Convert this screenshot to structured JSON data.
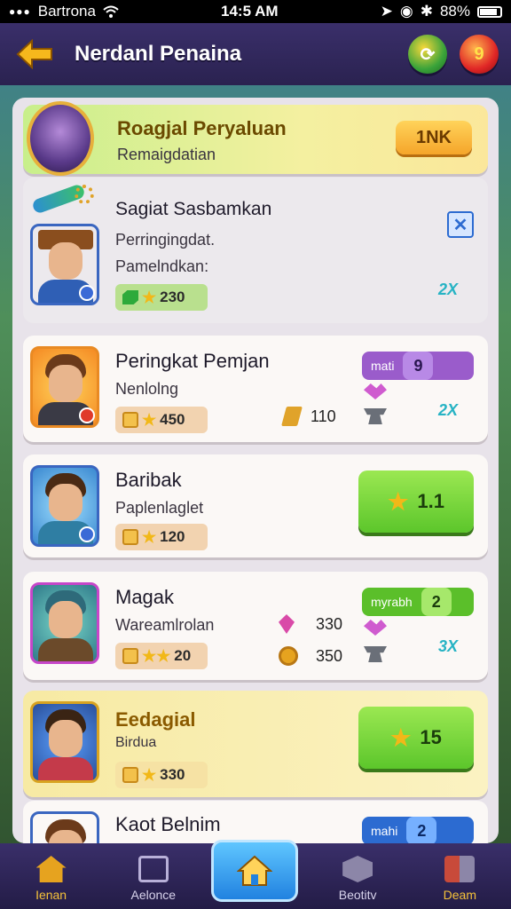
{
  "status_bar": {
    "carrier": "Bartrona",
    "time": "14:5 AM",
    "battery": "88%"
  },
  "header": {
    "title": "Nerdanl Penaina",
    "back_icon": "back-arrow-icon",
    "btn1_icon": "refresh-icon",
    "btn2_label": "9"
  },
  "cards": [
    {
      "name": "Roagjal Peryaluan",
      "sub": "Remaigdatian",
      "button": "1NK"
    },
    {
      "name": "Sagiat Sasbamkan",
      "line1": "Perringingdat.",
      "line2": "Pamelndkan:",
      "score": "230",
      "mult": "2X"
    },
    {
      "name": "Peringkat Pemjan",
      "sub": "Nenlolng",
      "score": "450",
      "pill_label": "mati",
      "pill_value": "9",
      "res_value": "110",
      "mult": "2X"
    },
    {
      "name": "Baribak",
      "sub": "Paplenlaglet",
      "score": "120",
      "button": "1.1"
    },
    {
      "name": "Magak",
      "sub": "Wareamlrolan",
      "score": "20",
      "pill_label": "myrabh",
      "pill_value": "2",
      "res1": "330",
      "res2": "350",
      "mult": "3X"
    },
    {
      "name": "Eedagial",
      "sub": "Birdua",
      "score": "330",
      "button": "15"
    },
    {
      "name": "Kaot Belnim",
      "pill_label": "mahi",
      "pill_value": "2"
    }
  ],
  "nav": {
    "item1": "Ienan",
    "item2": "Aelonce",
    "item4": "Beotitv",
    "item5": "Deam"
  },
  "colors": {
    "header": "#2a2250",
    "green_button": "#5cc62b",
    "accent_gold": "#f5a52a"
  }
}
